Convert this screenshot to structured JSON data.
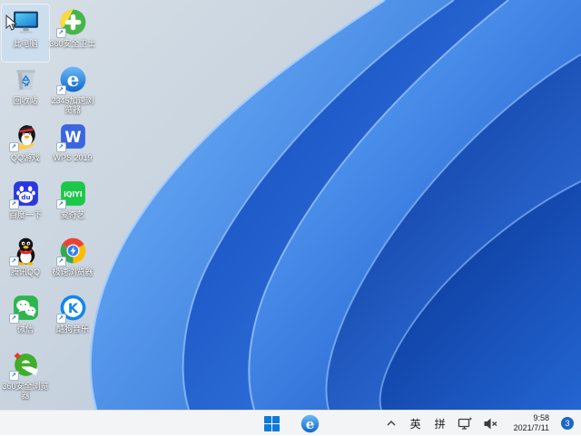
{
  "wallpaper": {
    "style": "windows-11-bloom",
    "background_color": "#c6d2de",
    "bloom_colors": [
      "#0b3a9b",
      "#1850c0",
      "#3e86ec",
      "#66a9f5"
    ]
  },
  "desktop": {
    "icons": [
      {
        "name": "this-pc",
        "label": "此电脑",
        "shortcut": false,
        "selected": true
      },
      {
        "name": "360-safe",
        "label": "360安全卫士",
        "shortcut": true,
        "selected": false
      },
      {
        "name": "recycle-bin",
        "label": "回收站",
        "shortcut": false,
        "selected": false
      },
      {
        "name": "2345-browser",
        "label": "2345加速浏览器",
        "shortcut": true,
        "selected": false
      },
      {
        "name": "qq-games",
        "label": "QQ游戏",
        "shortcut": true,
        "selected": false
      },
      {
        "name": "wps-2019",
        "label": "WPS 2019",
        "shortcut": true,
        "selected": false
      },
      {
        "name": "baidu",
        "label": "百度一下",
        "shortcut": true,
        "selected": false
      },
      {
        "name": "iqiyi",
        "label": "爱奇艺",
        "shortcut": true,
        "selected": false
      },
      {
        "name": "tencent-qq",
        "label": "腾讯QQ",
        "shortcut": true,
        "selected": false
      },
      {
        "name": "speed-browser",
        "label": "极速浏览器",
        "shortcut": true,
        "selected": false
      },
      {
        "name": "wechat",
        "label": "微信",
        "shortcut": true,
        "selected": false
      },
      {
        "name": "kugou-music",
        "label": "酷狗音乐",
        "shortcut": true,
        "selected": false
      },
      {
        "name": "360-secure-browser",
        "label": "360安全浏览器",
        "shortcut": true,
        "selected": false
      }
    ]
  },
  "taskbar": {
    "background": "#f3f4f6",
    "start_icon": "windows-logo",
    "pinned_icons": [
      "browser-e"
    ],
    "tray": {
      "hidden_icons": "chevron-up",
      "language_indicators": [
        "英",
        "拼"
      ],
      "status_icons": [
        "network",
        "volume-muted"
      ],
      "time": "9:58",
      "date": "2021/7/11",
      "notification_count": "3"
    }
  }
}
